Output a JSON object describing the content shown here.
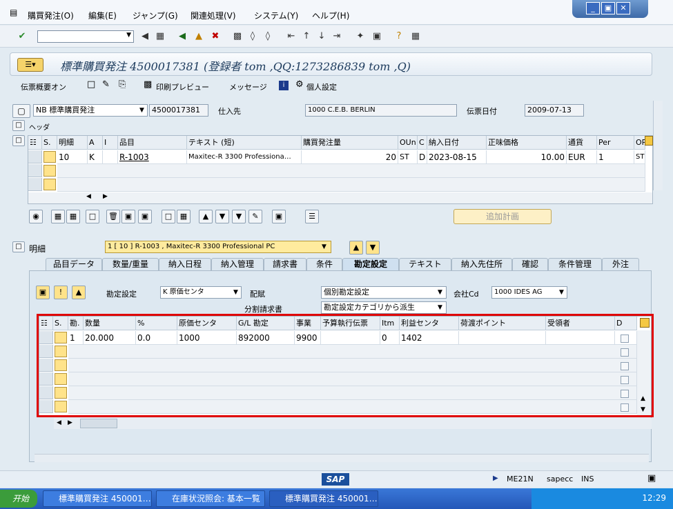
{
  "menu": {
    "items": [
      "購買発注(O)",
      "編集(E)",
      "ジャンプ(G)",
      "関連処理(V)",
      "システム(Y)",
      "ヘルプ(H)"
    ]
  },
  "window": {
    "title": "標準購買発注 4500017381 (登録者 tom ,QQ:1273286839 tom ,Q)"
  },
  "appbar": {
    "items": [
      "伝票概要オン",
      "印刷プレビュー",
      "メッセージ",
      "個人設定"
    ]
  },
  "header": {
    "doctype": "NB 標準購買発注",
    "po_number": "4500017381",
    "vendor_label": "仕入先",
    "vendor_value": "1000 C.E.B. BERLIN",
    "date_label": "伝票日付",
    "date_value": "2009-07-13",
    "header_label": "ヘッダ"
  },
  "items_table": {
    "headers": [
      "S.",
      "明細",
      "A",
      "I",
      "品目",
      "テキスト (短)",
      "購買発注量",
      "OUn",
      "C",
      "納入日付",
      "正味価格",
      "通貨",
      "Per",
      "OP"
    ],
    "row": [
      "10",
      "K",
      "",
      "R-1003",
      "Maxitec-R 3300 Professiona…",
      "20",
      "ST",
      "D",
      "2023-08-15",
      "10.00",
      "EUR",
      "1",
      "ST"
    ]
  },
  "plan_button": "追加計画",
  "detail": {
    "label": "明細",
    "selected": "1 [ 10 ] R-1003 , Maxitec-R 3300 Professional PC"
  },
  "tabs": [
    "品目データ",
    "数量/重量",
    "納入日程",
    "納入管理",
    "請求書",
    "条件",
    "勘定設定",
    "テキスト",
    "納入先住所",
    "確認",
    "条件管理",
    "外注"
  ],
  "acct": {
    "label1": "勘定設定",
    "value1": "K 原価センタ",
    "label2": "配賦",
    "value2": "個別勘定設定",
    "label3": "会社Cd",
    "value3": "1000 IDES AG",
    "label4": "分割請求書",
    "value4": "勘定設定カテゴリから派生"
  },
  "acct_table": {
    "headers": [
      "S.",
      "勘.",
      "数量",
      "%",
      "原価センタ",
      "G/L 勘定",
      "事業",
      "予算執行伝票",
      "Itm",
      "利益センタ",
      "荷渡ポイント",
      "受領者",
      "D"
    ],
    "row": [
      "1",
      "20.000",
      "0.0",
      "1000",
      "892000",
      "9900",
      "",
      "0",
      "1402",
      "",
      "",
      ""
    ]
  },
  "status": {
    "tcode": "ME21N",
    "server": "sapecc",
    "mode": "INS",
    "sap": "SAP"
  },
  "taskbar": {
    "start": "开始",
    "tasks": [
      "標準購買発注 450001…",
      "在庫状況照会: 基本一覧",
      "標準購買発注 450001…"
    ],
    "clock": "12:29"
  }
}
